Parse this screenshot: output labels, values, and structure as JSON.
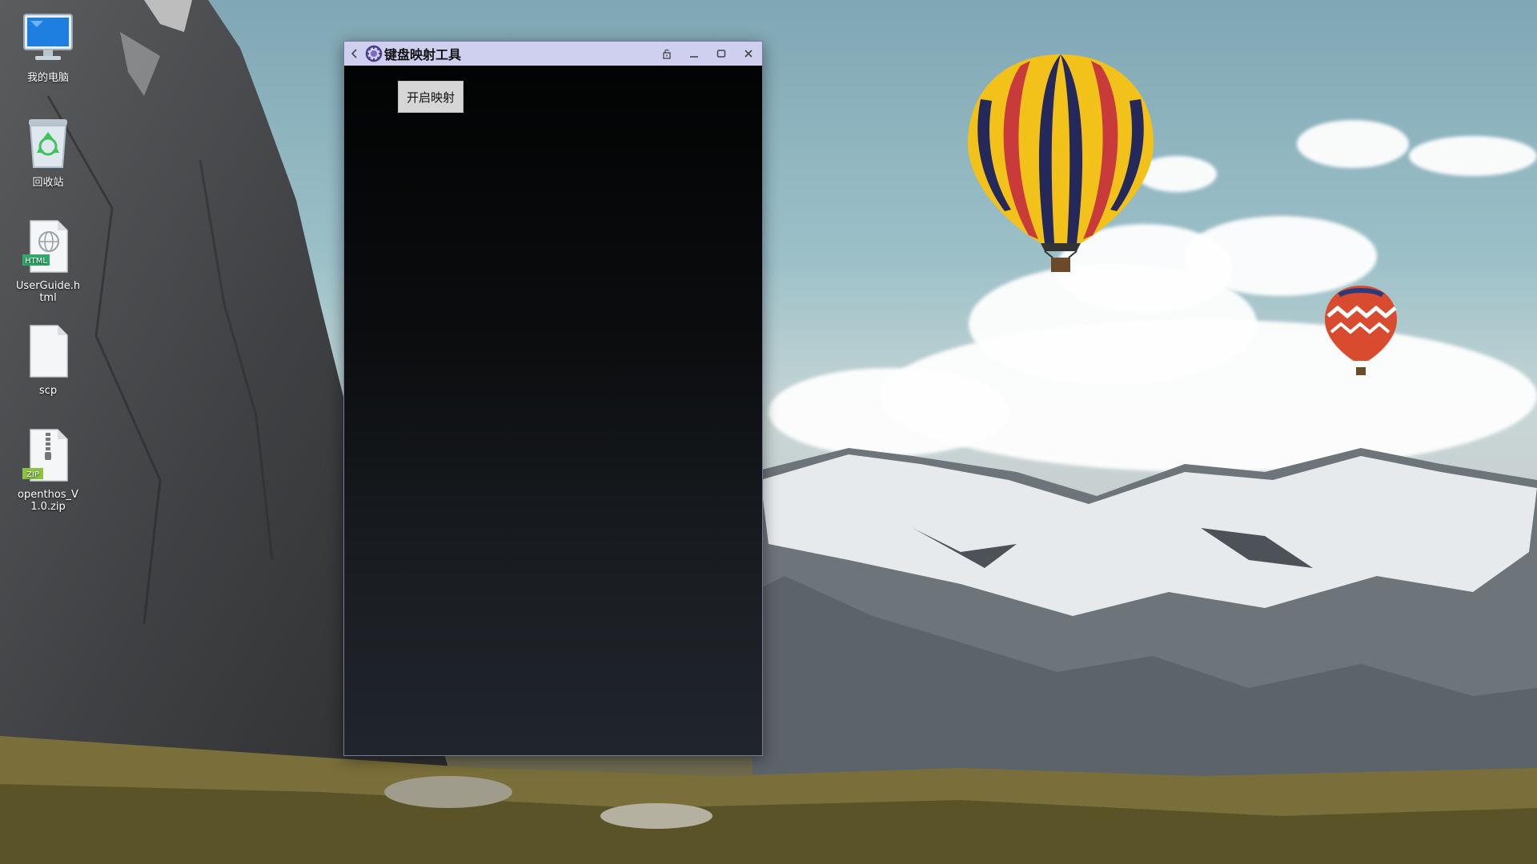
{
  "desktop": {
    "icons": [
      {
        "label": "我的电脑",
        "icon": "computer-monitor-icon"
      },
      {
        "label": "回收站",
        "icon": "recycle-bin-icon"
      },
      {
        "label": "UserGuide.html",
        "icon": "html-file-icon",
        "badge": "HTML"
      },
      {
        "label": "scp",
        "icon": "blank-file-icon"
      },
      {
        "label": "openthos_V1.0.zip",
        "icon": "zip-file-icon",
        "badge": "ZIP"
      }
    ]
  },
  "window": {
    "title": "键盘映射工具",
    "controls": [
      "back-icon",
      "lock-rotate-icon",
      "minimize-icon",
      "maximize-icon",
      "close-icon"
    ],
    "titlebar_color": "#cfcfef",
    "content": {
      "start_button_label": "开启映射"
    }
  }
}
